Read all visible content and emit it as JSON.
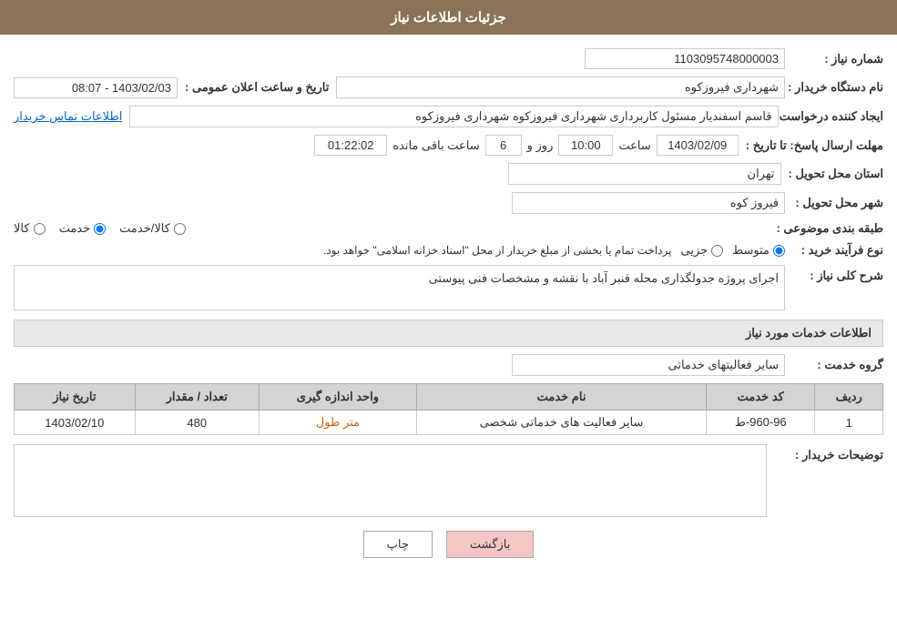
{
  "header": {
    "title": "جزئیات اطلاعات نیاز"
  },
  "fields": {
    "need_number_label": "شماره نیاز :",
    "need_number_value": "1103095748000003",
    "buyer_org_label": "نام دستگاه خریدار :",
    "buyer_org_value": "شهرداری فیروزکوه",
    "creator_label": "ایجاد کننده درخواست :",
    "creator_value": "قاسم اسفندیار مسئول کاربرداری شهرداری فیروزکوه شهرداری فیروزکوه",
    "creator_link": "اطلاعات تماس خریدار",
    "announce_datetime_label": "تاریخ و ساعت اعلان عمومی :",
    "announce_datetime_value": "1403/02/03 - 08:07",
    "response_deadline_label": "مهلت ارسال پاسخ: تا تاریخ :",
    "response_date": "1403/02/09",
    "response_time_label": "ساعت",
    "response_time": "10:00",
    "response_days_label": "روز و",
    "response_days": "6",
    "remaining_label": "ساعت باقی مانده",
    "remaining_time": "01:22:02",
    "province_label": "استان محل تحویل :",
    "province_value": "تهران",
    "city_label": "شهر محل تحویل :",
    "city_value": "فیروز کوه",
    "category_label": "طبقه بندی موضوعی :",
    "category_options": [
      {
        "label": "کالا",
        "value": "kala"
      },
      {
        "label": "خدمت",
        "value": "khedmat"
      },
      {
        "label": "کالا/خدمت",
        "value": "kala_khedmat"
      }
    ],
    "category_selected": "khedmat",
    "process_label": "نوع فرآیند خرید :",
    "process_options": [
      {
        "label": "جزیی",
        "value": "jozi"
      },
      {
        "label": "متوسط",
        "value": "motavasset"
      }
    ],
    "process_selected": "motavasset",
    "process_note": "پرداخت تمام یا بخشی از مبلغ خریدار از محل \"اسناد خزانه اسلامی\" خواهد بود.",
    "general_desc_label": "شرح کلی نیاز :",
    "general_desc_value": "اجرای پروژه جدولگذاری محله قنبر آباد با نقشه و مشخصات فنی پیوستی",
    "services_section_title": "اطلاعات خدمات مورد نیاز",
    "service_group_label": "گروه خدمت :",
    "service_group_value": "سایر فعالیتهای خدماتی",
    "table_headers": [
      "ردیف",
      "کد خدمت",
      "نام خدمت",
      "واحد اندازه گیری",
      "تعداد / مقدار",
      "تاریخ نیاز"
    ],
    "table_rows": [
      {
        "row": "1",
        "code": "960-96-ط",
        "name": "سایر فعالیت های خدماتی شخصی",
        "unit": "متر طول",
        "quantity": "480",
        "date": "1403/02/10"
      }
    ],
    "buyer_desc_label": "توضیحات خریدار :",
    "buyer_desc_value": ""
  },
  "buttons": {
    "print_label": "چاپ",
    "back_label": "بازگشت"
  }
}
